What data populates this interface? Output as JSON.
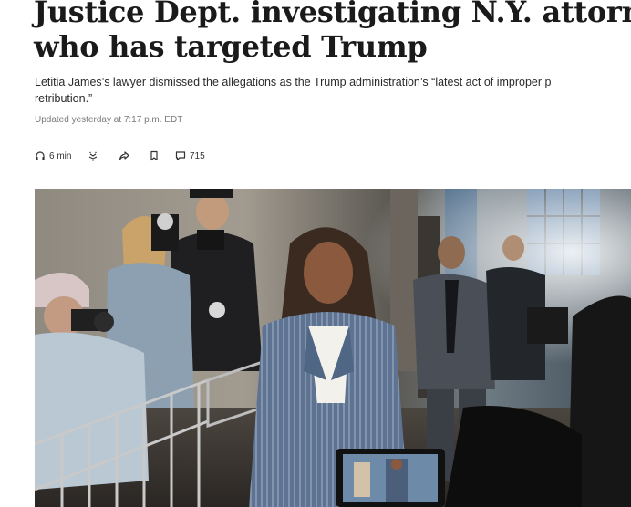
{
  "article": {
    "headline_line1": "Justice Dept. investigating N.Y. attorney gen",
    "headline_line2": "who has targeted Trump",
    "dek_line1": "Letitia James’s lawyer dismissed the allegations as the Trump administration’s “latest act of improper p",
    "dek_line2": "retribution.”",
    "updated": "Updated yesterday at 7:17 p.m. EDT"
  },
  "toolbar": {
    "listen_label": "6 min",
    "comments_count": "715",
    "icons": [
      "headphones-icon",
      "gift-icon",
      "share-icon",
      "bookmark-icon",
      "comment-icon"
    ]
  },
  "photo": {
    "icon": "news-photo"
  }
}
